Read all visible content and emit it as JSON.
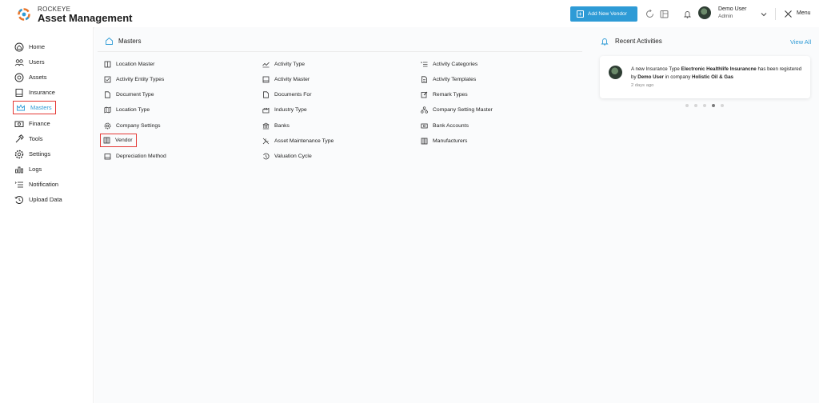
{
  "header": {
    "brand_small": "ROCKEYE",
    "brand_title": "Asset Management",
    "add_button": "Add New Vendor",
    "user_name": "Demo User",
    "user_role": "Admin",
    "menu_label": "Menu"
  },
  "sidebar": {
    "items": [
      {
        "label": "Home",
        "icon": "home-icon"
      },
      {
        "label": "Users",
        "icon": "users-icon"
      },
      {
        "label": "Assets",
        "icon": "assets-icon"
      },
      {
        "label": "Insurance",
        "icon": "insurance-icon"
      },
      {
        "label": "Masters",
        "icon": "crown-icon"
      },
      {
        "label": "Finance",
        "icon": "finance-icon"
      },
      {
        "label": "Tools",
        "icon": "tools-icon"
      },
      {
        "label": "Settings",
        "icon": "settings-icon"
      },
      {
        "label": "Logs",
        "icon": "logs-icon"
      },
      {
        "label": "Notification",
        "icon": "notification-icon"
      },
      {
        "label": "Upload Data",
        "icon": "upload-icon"
      }
    ],
    "active": "Masters",
    "active_color": "#2e9bd6",
    "highlight_color": "#e53935"
  },
  "masters": {
    "title": "Masters",
    "col1": [
      "Location Master",
      "Activity Entity Types",
      "Document Type",
      "Location Type",
      "Company Settings",
      "Vendor",
      "Depreciation Method"
    ],
    "col2": [
      "Activity Type",
      "Activity Master",
      "Documents For",
      "Industry Type",
      "Banks",
      "Asset Maintenance Type",
      "Valuation Cycle"
    ],
    "col3": [
      "Activity Categories",
      "Activity Templates",
      "Remark Types",
      "Company Setting Master",
      "Bank Accounts",
      "Manufacturers"
    ],
    "highlighted_item": "Vendor"
  },
  "recent": {
    "title": "Recent Activities",
    "view_all": "View All",
    "activity": {
      "prefix": "A new Insurance Type ",
      "entity": "Electronic Healthlife Insurancne",
      "middle": " has been registered by ",
      "user": "Demo User",
      "mid2": " in company ",
      "company": "Holistic Oil & Gas",
      "time": "2 days ago"
    },
    "carousel_pages": 5,
    "carousel_active_index": 3
  }
}
